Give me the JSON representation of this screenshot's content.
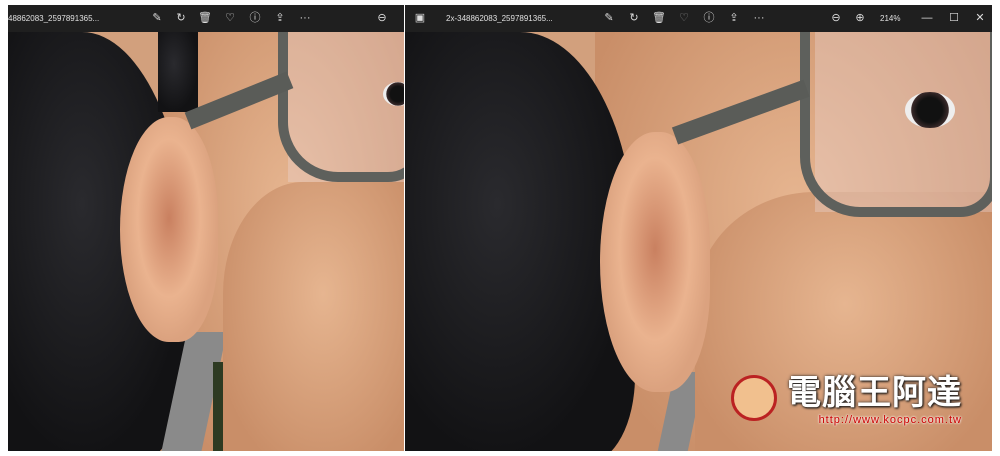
{
  "left_window": {
    "title": "48862083_2597891365...",
    "toolbar": [
      "edit-icon",
      "rotate-icon",
      "delete-icon",
      "favorite-icon",
      "info-icon",
      "share-icon",
      "more-icon"
    ],
    "more": "···",
    "zoom_out": "zoom-out-icon"
  },
  "right_window": {
    "title": "2x-348862083_2597891365...",
    "zoom_level": "214%",
    "toolbar": [
      "edit-icon",
      "rotate-icon",
      "delete-icon",
      "favorite-icon",
      "info-icon",
      "share-icon",
      "more-icon"
    ],
    "more": "···"
  },
  "watermark": {
    "text": "電腦王阿達",
    "url": "http://www.kocpc.com.tw"
  }
}
